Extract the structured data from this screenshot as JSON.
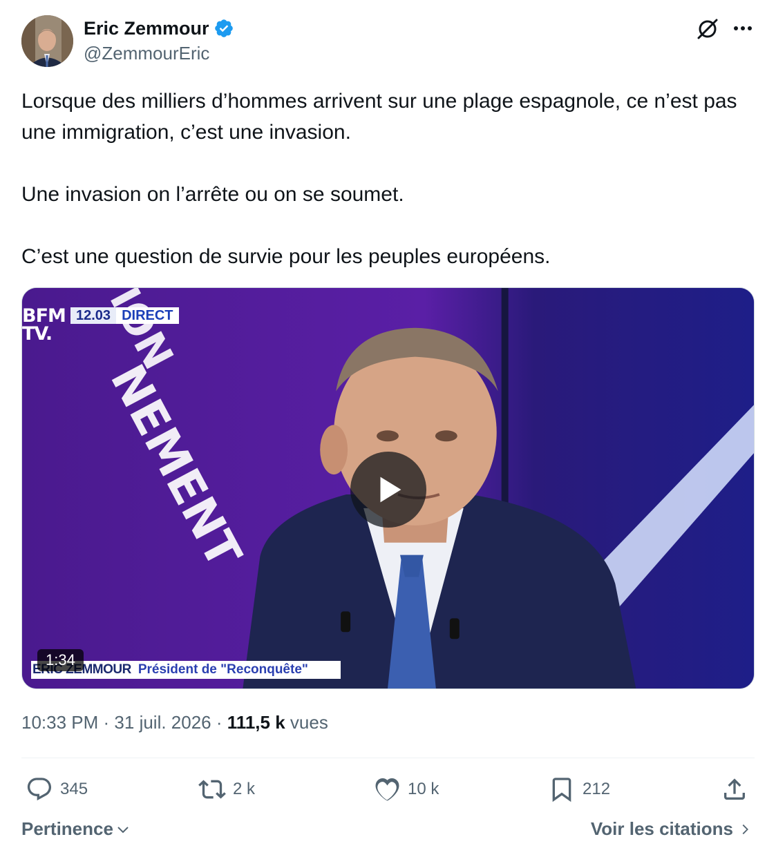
{
  "author": {
    "name": "Eric Zemmour",
    "handle": "@ZemmourEric",
    "verified": true,
    "verified_color": "#1d9bf0"
  },
  "header_icons": [
    "grok-icon",
    "more-icon"
  ],
  "tweet": {
    "paragraphs": [
      "Lorsque des milliers d’hommes arrivent sur une plage espagnole, ce n’est pas une immigration, c’est une invasion.",
      "Une invasion on l’arrête ou on se soumet.",
      "C’est une question de survie pour les peuples européens."
    ]
  },
  "media": {
    "channel_logo": "BFM\nTV.",
    "live_time": "12.03",
    "live_label": "DIRECT",
    "lower_third_name": "ERIC ZEMMOUR",
    "lower_third_role": "Président de \"Reconquête\"",
    "duration": "1:34"
  },
  "meta": {
    "time": "10:33 PM",
    "date": "31 juil. 2026",
    "views_count": "111,5 k",
    "views_label": "vues"
  },
  "actions": {
    "replies": "345",
    "reposts": "2 k",
    "likes": "10 k",
    "bookmarks": "212"
  },
  "footer": {
    "sort_label": "Pertinence",
    "quotes_label": "Voir les citations"
  },
  "colors": {
    "text_primary": "#0f1419",
    "text_secondary": "#536471",
    "accent": "#1d9bf0",
    "media_bg": "#3a1a8a"
  }
}
